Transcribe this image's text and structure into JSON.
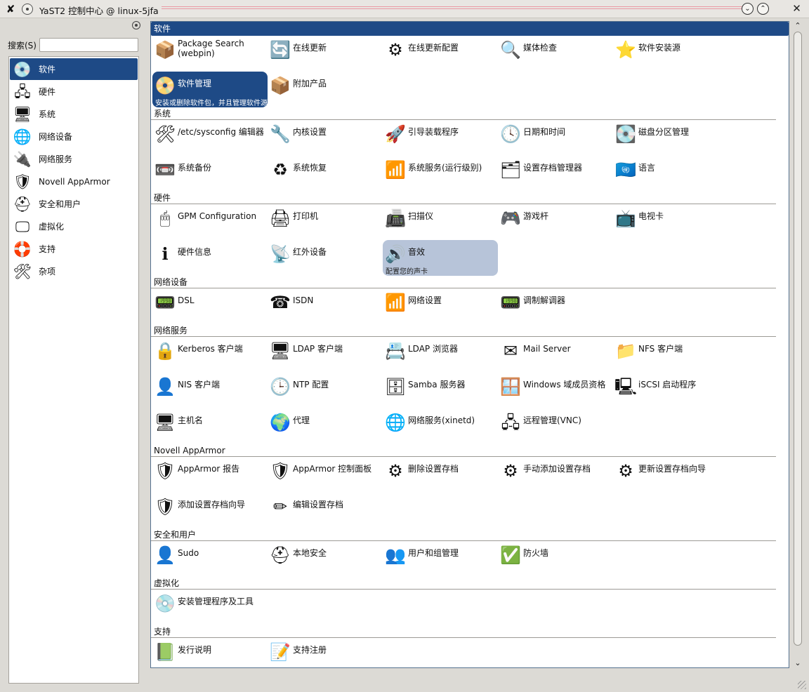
{
  "window": {
    "title": "YaST2 控制中心 @ linux-5jfa",
    "app_icon": "yast-x-icon",
    "buttons": {
      "minimize": "⌄",
      "maximize": "⌃",
      "close": "✕"
    }
  },
  "sidebar": {
    "search_label": "搜索(S)",
    "search_value": "",
    "items": [
      {
        "label": "软件",
        "icon": "💿",
        "selected": true
      },
      {
        "label": "硬件",
        "icon": "🖧"
      },
      {
        "label": "系统",
        "icon": "🖥"
      },
      {
        "label": "网络设备",
        "icon": "🌐"
      },
      {
        "label": "网络服务",
        "icon": "🔌"
      },
      {
        "label": "Novell AppArmor",
        "icon": "🛡"
      },
      {
        "label": "安全和用户",
        "icon": "⛑"
      },
      {
        "label": "虚拟化",
        "icon": "🖵"
      },
      {
        "label": "支持",
        "icon": "🛟"
      },
      {
        "label": "杂项",
        "icon": "🛠"
      }
    ]
  },
  "sections": [
    {
      "title": "软件",
      "modules": [
        {
          "label": "Package Search (webpin)",
          "icon": "📦",
          "two_line": true
        },
        {
          "label": "在线更新",
          "icon": "🔄"
        },
        {
          "label": "在线更新配置",
          "icon": "⚙"
        },
        {
          "label": "媒体检查",
          "icon": "🔍"
        },
        {
          "label": "软件安装源",
          "icon": "⭐"
        },
        {
          "label": "软件管理",
          "icon": "📀",
          "active": true,
          "desc": "安装或删除软件包，并且管理软件源"
        },
        {
          "label": "附加产品",
          "icon": "📦"
        }
      ]
    },
    {
      "title": "系统",
      "modules": [
        {
          "label": "/etc/sysconfig 编辑器",
          "icon": "🛠"
        },
        {
          "label": "内核设置",
          "icon": "🔧"
        },
        {
          "label": "引导装载程序",
          "icon": "🚀"
        },
        {
          "label": "日期和时间",
          "icon": "🕓"
        },
        {
          "label": "磁盘分区管理",
          "icon": "💽"
        },
        {
          "label": "系统备份",
          "icon": "📼"
        },
        {
          "label": "系统恢复",
          "icon": "♻"
        },
        {
          "label": "系统服务(运行级别)",
          "icon": "📶"
        },
        {
          "label": "设置存档管理器",
          "icon": "🗂"
        },
        {
          "label": "语言",
          "icon": "🇺🇳"
        }
      ]
    },
    {
      "title": "硬件",
      "modules": [
        {
          "label": "GPM Configuration",
          "icon": "🖱"
        },
        {
          "label": "打印机",
          "icon": "🖨"
        },
        {
          "label": "扫描仪",
          "icon": "📠"
        },
        {
          "label": "游戏杆",
          "icon": "🎮"
        },
        {
          "label": "电视卡",
          "icon": "📺"
        },
        {
          "label": "硬件信息",
          "icon": "ℹ"
        },
        {
          "label": "红外设备",
          "icon": "📡"
        },
        {
          "label": "音效",
          "icon": "🔊",
          "hover": true,
          "desc": "配置您的声卡"
        }
      ]
    },
    {
      "title": "网络设备",
      "modules": [
        {
          "label": "DSL",
          "icon": "📟"
        },
        {
          "label": "ISDN",
          "icon": "☎"
        },
        {
          "label": "网络设置",
          "icon": "📶"
        },
        {
          "label": "调制解调器",
          "icon": "📟"
        }
      ]
    },
    {
      "title": "网络服务",
      "modules": [
        {
          "label": "Kerberos 客户端",
          "icon": "🔒"
        },
        {
          "label": "LDAP 客户端",
          "icon": "🖥"
        },
        {
          "label": "LDAP 浏览器",
          "icon": "📇"
        },
        {
          "label": "Mail Server",
          "icon": "✉"
        },
        {
          "label": "NFS 客户端",
          "icon": "📁"
        },
        {
          "label": "NIS 客户端",
          "icon": "👤"
        },
        {
          "label": "NTP 配置",
          "icon": "🕒"
        },
        {
          "label": "Samba 服务器",
          "icon": "🗄"
        },
        {
          "label": "Windows 域成员资格",
          "icon": "🪟"
        },
        {
          "label": "iSCSI 启动程序",
          "icon": "🖳"
        },
        {
          "label": "主机名",
          "icon": "🖥"
        },
        {
          "label": "代理",
          "icon": "🌍"
        },
        {
          "label": "网络服务(xinetd)",
          "icon": "🌐"
        },
        {
          "label": "远程管理(VNC)",
          "icon": "🖧"
        }
      ]
    },
    {
      "title": "Novell AppArmor",
      "modules": [
        {
          "label": "AppArmor 报告",
          "icon": "🛡"
        },
        {
          "label": "AppArmor 控制面板",
          "icon": "🛡"
        },
        {
          "label": "删除设置存档",
          "icon": "⚙"
        },
        {
          "label": "手动添加设置存档",
          "icon": "⚙"
        },
        {
          "label": "更新设置存档向导",
          "icon": "⚙"
        },
        {
          "label": "添加设置存档向导",
          "icon": "🛡"
        },
        {
          "label": "编辑设置存档",
          "icon": "✏"
        }
      ]
    },
    {
      "title": "安全和用户",
      "modules": [
        {
          "label": "Sudo",
          "icon": "👤"
        },
        {
          "label": "本地安全",
          "icon": "⛑"
        },
        {
          "label": "用户和组管理",
          "icon": "👥"
        },
        {
          "label": "防火墙",
          "icon": "✅"
        }
      ]
    },
    {
      "title": "虚拟化",
      "modules": [
        {
          "label": "安装管理程序及工具",
          "icon": "💿"
        }
      ]
    },
    {
      "title": "支持",
      "modules": [
        {
          "label": "发行说明",
          "icon": "📗"
        },
        {
          "label": "支持注册",
          "icon": "📝"
        }
      ]
    }
  ],
  "scrollbar": {
    "up": "⌃",
    "down": "⌄"
  }
}
